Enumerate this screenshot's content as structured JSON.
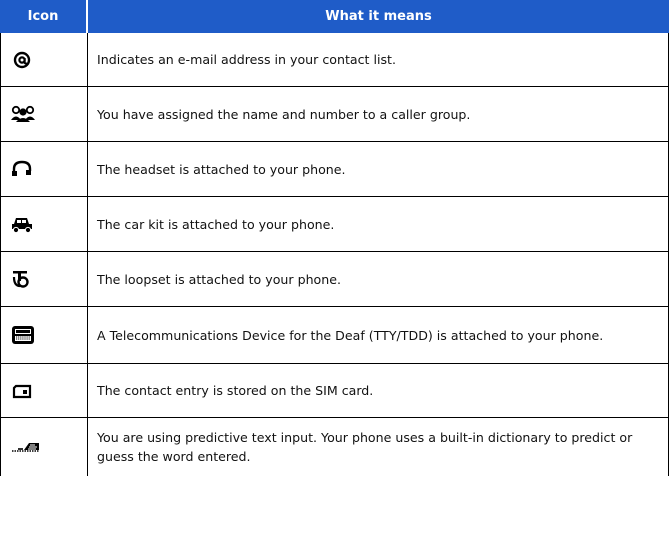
{
  "header": {
    "col_icon": "Icon",
    "col_meaning": "What it means"
  },
  "rows": [
    {
      "icon": "at-sign-icon",
      "text": "Indicates an e-mail address in your contact list."
    },
    {
      "icon": "caller-group-icon",
      "text": "You have assigned the name and number to a caller group."
    },
    {
      "icon": "headset-icon",
      "text": "The headset is attached to your phone."
    },
    {
      "icon": "car-icon",
      "text": "The car kit is attached to your phone."
    },
    {
      "icon": "loopset-icon",
      "text": "The loopset is attached to your phone."
    },
    {
      "icon": "tty-device-icon",
      "text": "A Telecommunications Device for the Deaf (TTY/TDD) is attached to your phone."
    },
    {
      "icon": "sim-card-icon",
      "text": "The contact entry is stored on the SIM card."
    },
    {
      "icon": "predictive-text-icon",
      "text": "You are using predictive text input. Your phone uses a built-in dictionary to predict or guess the word entered."
    }
  ],
  "colors": {
    "header_bg": "#1f5cc8",
    "header_text": "#ffffff",
    "border": "#000000"
  }
}
